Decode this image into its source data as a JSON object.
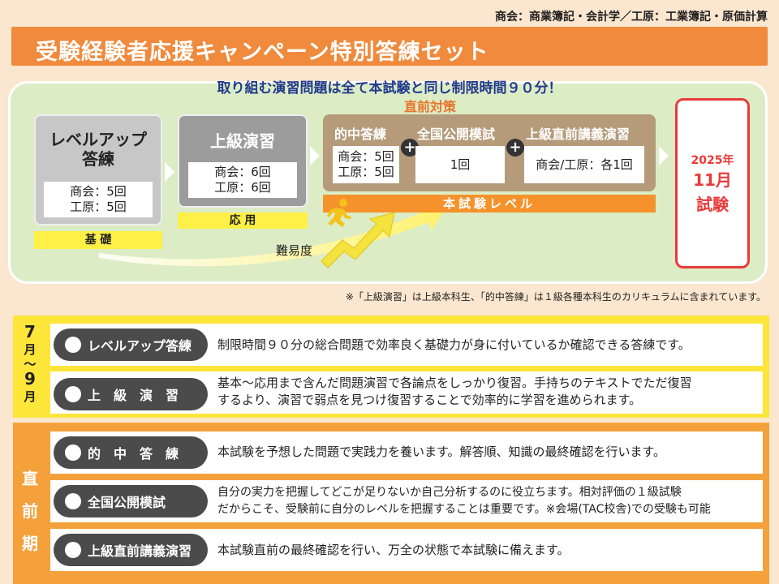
{
  "header": {
    "subjects": "商会：商業簿記・会計学／工原：工業簿記・原価計算",
    "title": "受験経験者応援キャンペーン特別答練セット"
  },
  "flow": {
    "headline": "取り組む演習問題は全て本試験と同じ制限時間９０分！",
    "level_up": {
      "title_line1": "レベルアップ",
      "title_line2": "答練",
      "count1": "商会：5回",
      "count2": "工原：5回",
      "band": "基 礎"
    },
    "advanced": {
      "title": "上級演習",
      "count1": "商会：6回",
      "count2": "工原：6回",
      "band": "応 用"
    },
    "pre_exam": {
      "label": "直前対策",
      "items": [
        {
          "title": "的中答練",
          "line1": "商会：5回",
          "line2": "工原：5回"
        },
        {
          "title": "全国公開模試",
          "line1": "1回",
          "line2": ""
        },
        {
          "title": "上級直前講義演習",
          "line1": "商会/工原：各1回",
          "line2": ""
        }
      ],
      "plus": "+",
      "band": "本試験レベル"
    },
    "exam": {
      "year": "2025年",
      "month": "11月",
      "label": "試験"
    },
    "difficulty": "難易度"
  },
  "note": "※「上級演習」は上級本科生、「的中答練」は１級各種本科生のカリキュラムに含まれています。",
  "schedule": {
    "period1": {
      "label_lines": [
        "7",
        "月",
        "〜",
        "9",
        "月"
      ],
      "rows": [
        {
          "name": "レベルアップ答練",
          "desc": [
            "制限時間９０分の総合問題で効率良く基礎力が身に付いているか確認できる答練です。"
          ]
        },
        {
          "name": "上　級　演　習",
          "desc": [
            "基本〜応用まで含んだ問題演習で各論点をしっかり復習。手持ちのテキストでただ復習",
            "するより、演習で弱点を見つけ復習することで効率的に学習を進められます。"
          ]
        }
      ]
    },
    "period2": {
      "label_lines": [
        "直",
        "前",
        "期"
      ],
      "rows": [
        {
          "name": "的　中　答　練",
          "desc": [
            "本試験を予想した問題で実践力を養います。解答順、知識の最終確認を行います。"
          ]
        },
        {
          "name": "全国公開模試",
          "desc": [
            "自分の実力を把握してどこが足りないか自己分析するのに役立ちます。相対評価の１級試験",
            "だからこそ、受験前に自分のレベルを把握することは重要です。※会場(TAC校舎)での受験も可能"
          ]
        },
        {
          "name": "上級直前講義演習",
          "desc": [
            "本試験直前の最終確認を行い、万全の状態で本試験に備えます。"
          ]
        }
      ]
    }
  },
  "colors": {
    "title_bar": "#f08a3c",
    "flow_panel": "#dcecc5",
    "headline": "#233a8c",
    "pre_exam_box": "#b59b7a",
    "pre_exam_band": "#f5922b",
    "exam_red": "#e83a3a",
    "period1": "#fde53a",
    "period2": "#f4a13c",
    "pill": "#4b4b4b"
  }
}
